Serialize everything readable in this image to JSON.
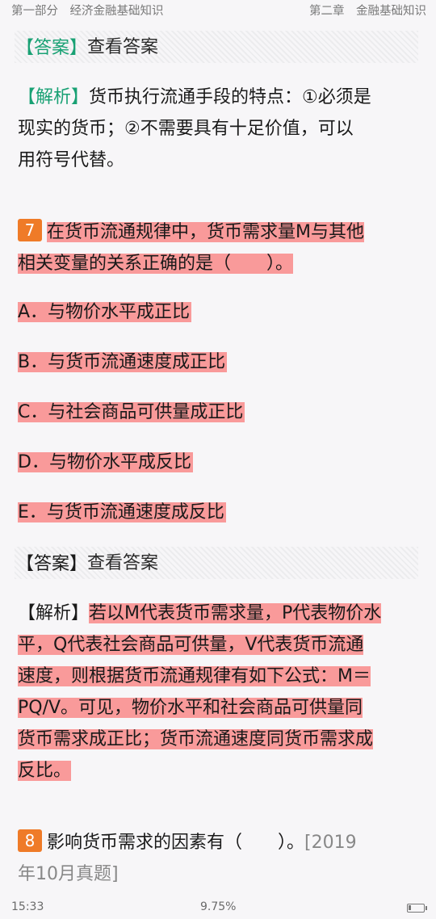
{
  "header": {
    "left": "第一部分　经济金融基础知识",
    "right": "第二章　金融基础知识"
  },
  "answer_block_1": {
    "bracket": "【答案】",
    "view_label": "查看答案"
  },
  "analysis_1": {
    "label": "【解析】",
    "lines": [
      "货币执行流通手段的特点：①必须是",
      "现实的货币；②不需要具有十足价值，可以",
      "用符号代替。"
    ]
  },
  "question_7": {
    "number": "7",
    "line1": "在货币流通规律中，货币需求量M与其他",
    "line2": "相关变量的关系正确的是（　　）。",
    "options": [
      "A．与物价水平成正比",
      "B．与货币流通速度成正比",
      "C．与社会商品可供量成正比",
      "D．与物价水平成反比",
      "E．与货币流通速度成反比"
    ]
  },
  "answer_block_2": {
    "bracket": "【答案】",
    "view_label": "查看答案"
  },
  "analysis_2": {
    "label": "【解析】",
    "first": "若以M代表货币需求量，P代表物价水",
    "lines": [
      "平，Q代表社会商品可供量，V代表货币流通",
      "速度，则根据货币流通规律有如下公式：M＝",
      "PQ/V。可见，物价水平和社会商品可供量同",
      "货币需求成正比；货币流通速度同货币需求成",
      "反比。"
    ]
  },
  "question_8": {
    "number": "8",
    "line1": "影响货币需求的因素有（　　）。",
    "source_1": "[2019",
    "source_2": "年10月真题]"
  },
  "status": {
    "time": "15:33",
    "progress": "9.75%",
    "battery_level": 0.2
  }
}
